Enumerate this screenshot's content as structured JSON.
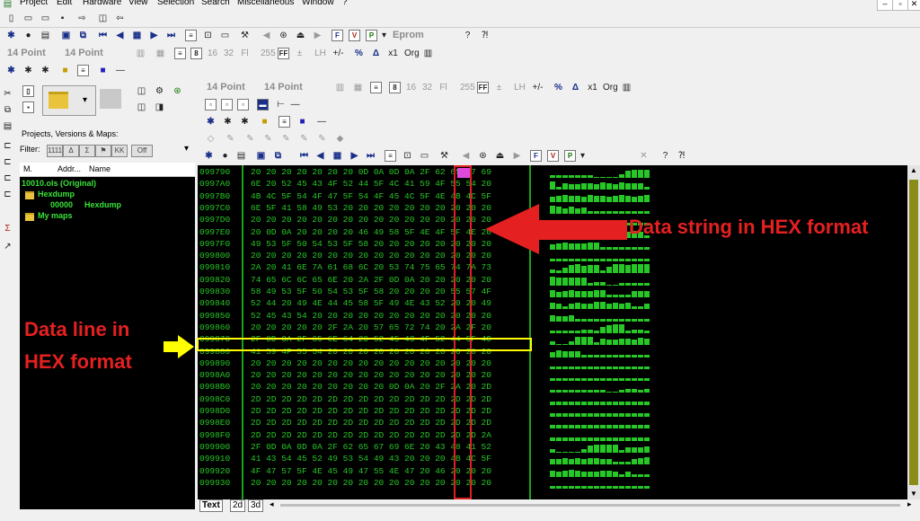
{
  "menu": [
    "Project",
    "Edit",
    "Hardware",
    "View",
    "Selection",
    "Search",
    "Miscellaneous",
    "Window",
    "?"
  ],
  "toolbar": {
    "eprom_label": "Eprom",
    "point_size_1": "14 Point",
    "point_size_2": "14 Point",
    "org_label": "Org",
    "x1_label": "x1",
    "percent_label": "%",
    "ff_label": "FF",
    "off_label": "Off"
  },
  "hex_toolbar": {
    "point_size_1": "14 Point",
    "point_size_2": "14 Point"
  },
  "project_panel": {
    "title": "Projects, Versions & Maps:",
    "filter_label": "Filter:",
    "filter_buttons": [
      "1111",
      "Δ",
      "Σ",
      "⚑",
      "KK",
      "Off"
    ],
    "columns": [
      "M.",
      "Addr...",
      "Name"
    ],
    "tree": {
      "root": "10010.ols (Original)",
      "folder1": "Hexdump",
      "item_addr": "00000",
      "item_name": "Hexdump",
      "folder2": "My maps"
    }
  },
  "hex": {
    "rows": [
      {
        "addr": "099790",
        "bytes": "20 20 20 20 20 20 20 0D 0A 0D 0A 2F 62 65 67 69"
      },
      {
        "addr": "0997A0",
        "bytes": "6E 20 52 45 43 4F 52 44 5F 4C 41 59 4F 55 54 20"
      },
      {
        "addr": "0997B0",
        "bytes": "4B 4C 5F 54 4F 47 5F 54 4F 45 4C 5F 4E 4B 4C 5F"
      },
      {
        "addr": "0997C0",
        "bytes": "6E 5F 41 58 49 53 20 20 20 20 20 20 20 20 20 20"
      },
      {
        "addr": "0997D0",
        "bytes": "20 20 20 20 20 20 20 20 20 20 20 20 20 20 20 20"
      },
      {
        "addr": "0997E0",
        "bytes": "20 0D 0A 20 20 20 20 46 49 58 5F 4E 4F 5F 4E 20"
      },
      {
        "addr": "0997F0",
        "bytes": "49 53 5F 50 54 53 5F 58 20 20 20 20 20 20 20 20"
      },
      {
        "addr": "099800",
        "bytes": "20 20 20 20 20 20 20 20 20 20 20 20 20 20 20 20"
      },
      {
        "addr": "099810",
        "bytes": "2A 20 41 6E 7A 61 68 6C 20 53 74 75 65 74 7A 73"
      },
      {
        "addr": "099820",
        "bytes": "74 65 6C 6C 65 6E 20 2A 2F 0D 0A 20 20 20 20 20"
      },
      {
        "addr": "099830",
        "bytes": "58 49 53 5F 50 54 53 5F 58 20 20 20 20 55 57 4F"
      },
      {
        "addr": "099840",
        "bytes": "52 44 20 49 4E 44 45 58 5F 49 4E 43 52 20 20 49"
      },
      {
        "addr": "099850",
        "bytes": "52 45 43 54 20 20 20 20 20 20 20 20 20 20 20 20"
      },
      {
        "addr": "099860",
        "bytes": "20 20 20 20 20 2F 2A 20 57 65 72 74 20 2A 2F 20"
      },
      {
        "addr": "099870",
        "bytes": "2F 0D 0A 2F 65 6E 64 20 52 45 43 4F 52 44 5F 4C"
      },
      {
        "addr": "099880",
        "bytes": "41 59 4F 55 54 20 20 20 20 20 20 20 20 20 20 20"
      },
      {
        "addr": "099890",
        "bytes": "20 20 20 20 20 20 20 20 20 20 20 20 20 20 20 20"
      },
      {
        "addr": "0998A0",
        "bytes": "20 20 20 20 20 20 20 20 20 20 20 20 20 20 20 20"
      },
      {
        "addr": "0998B0",
        "bytes": "20 20 20 20 20 20 20 20 20 0D 0A 20 2F 2A 20 2D"
      },
      {
        "addr": "0998C0",
        "bytes": "2D 2D 2D 2D 2D 2D 2D 2D 2D 2D 2D 2D 2D 2D 2D 2D"
      },
      {
        "addr": "0998D0",
        "bytes": "2D 2D 2D 2D 2D 2D 2D 2D 2D 2D 2D 2D 2D 2D 2D 2D"
      },
      {
        "addr": "0998E0",
        "bytes": "2D 2D 2D 2D 2D 2D 2D 2D 2D 2D 2D 2D 2D 2D 2D 2D"
      },
      {
        "addr": "0998F0",
        "bytes": "2D 2D 2D 2D 2D 2D 2D 2D 2D 2D 2D 2D 2D 2D 2D 2A"
      },
      {
        "addr": "099900",
        "bytes": "2F 0D 0A 0D 0A 2F 62 65 67 69 6E 20 43 48 41 52"
      },
      {
        "addr": "099910",
        "bytes": "41 43 54 45 52 49 53 54 49 43 20 20 20 4B 4C 5F"
      },
      {
        "addr": "099920",
        "bytes": "4F 47 57 5F 4E 45 49 47 55 4E 47 20 46 20 20 20"
      },
      {
        "addr": "099930",
        "bytes": "20 20 20 20 20 20 20 20 20 20 20 20 20 20 20 20"
      }
    ],
    "tabs": [
      "Text",
      "2d",
      "3d"
    ]
  },
  "annotations": {
    "string_label": "Data string in HEX format",
    "line_label_1": "Data line in",
    "line_label_2": "HEX format"
  },
  "colors": {
    "hex_text": "#26c726",
    "annotation_red": "#e52020",
    "annotation_yellow": "#ffff00",
    "highlight": "#e04ad9"
  }
}
